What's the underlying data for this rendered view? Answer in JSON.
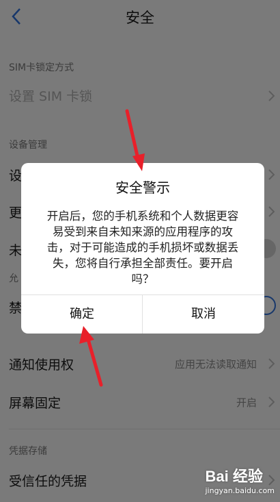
{
  "header": {
    "title": "安全",
    "back_icon": "chevron-left-icon"
  },
  "sections": {
    "sim": "SIM卡锁定方式",
    "device": "设备管理",
    "device_partial": "允",
    "credentials": "凭据存储"
  },
  "rows": {
    "sim_lock": "设置 SIM 卡锁",
    "device1_partial": "设",
    "device2_partial": "更",
    "unknown_partial": "未",
    "forbid_partial": "禁",
    "notification_access": "通知使用权",
    "notification_value": "应用无法读取通知",
    "screen_pin": "屏幕固定",
    "screen_pin_value": "开启",
    "trusted_credentials": "受信任的凭据"
  },
  "dialog": {
    "title": "安全警示",
    "message": "开启后，您的手机系统和个人数据更容易受到来自未知来源的应用程序的攻击，对于可能造成的手机损坏或数据丢失，您将自行承担全部责任。要开启吗？",
    "confirm": "确定",
    "cancel": "取消"
  },
  "watermark": {
    "logo": "Bai 经验",
    "url": "jingyan.baidu.com"
  },
  "colors": {
    "accent": "#2f6fd6",
    "annotation_arrow": "#e8202a",
    "overlay": "rgba(0,0,0,0.5)"
  }
}
